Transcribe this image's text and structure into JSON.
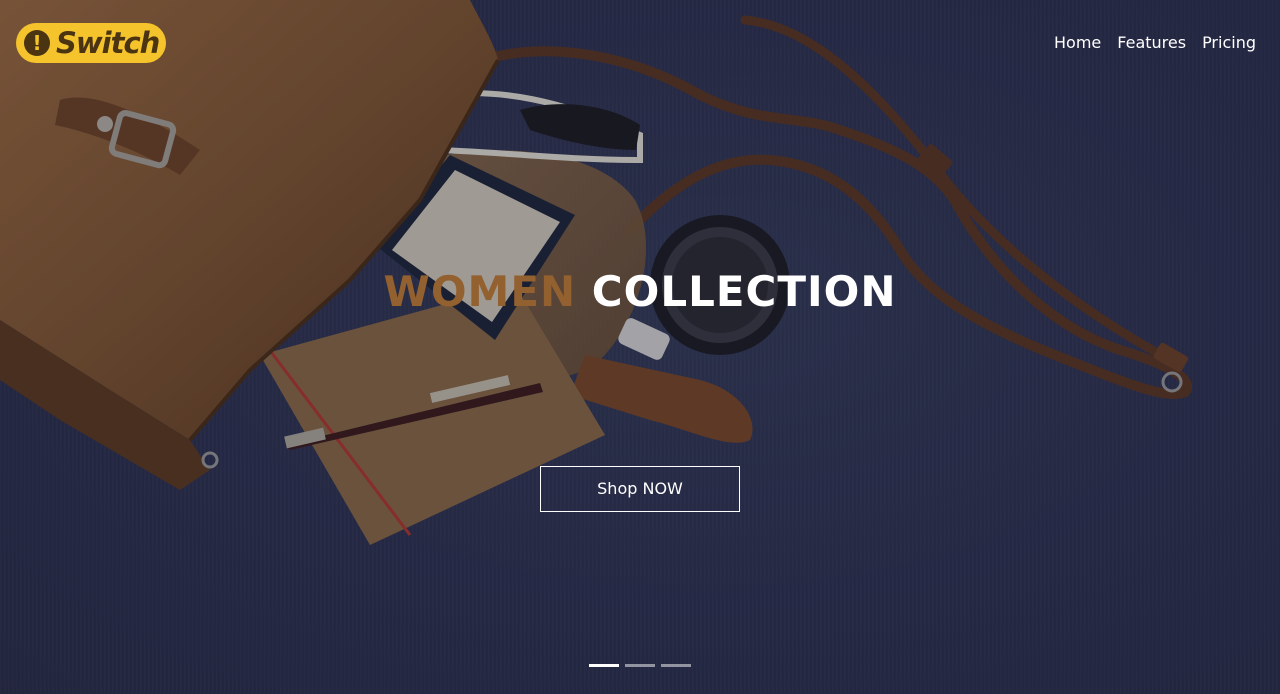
{
  "header": {
    "logo_mark": "!",
    "logo_text": "Switch",
    "nav": [
      {
        "label": "Home"
      },
      {
        "label": "Features"
      },
      {
        "label": "Pricing"
      }
    ]
  },
  "hero": {
    "headline_accent": "WOMEN",
    "headline_main": "COLLECTION",
    "cta_label": "Shop NOW",
    "slides_total": 3,
    "active_slide": 1
  },
  "colors": {
    "logo_bg": "#f5c32c",
    "logo_ink": "#4a3412",
    "accent_text": "#93602f",
    "background": "#2c3150"
  },
  "icons": {
    "logo": "exclamation-badge-icon"
  }
}
